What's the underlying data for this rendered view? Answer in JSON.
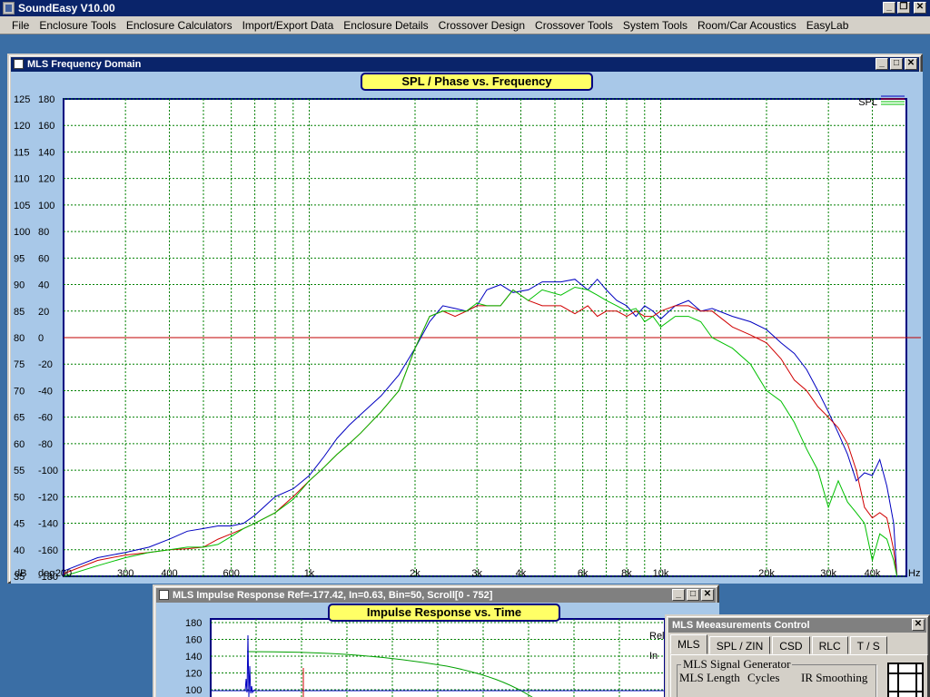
{
  "app": {
    "title": "SoundEasy V10.00"
  },
  "menu": [
    "File",
    "Enclosure Tools",
    "Enclosure Calculators",
    "Import/Export Data",
    "Enclosure Details",
    "Crossover Design",
    "Crossover Tools",
    "System Tools",
    "Room/Car Acoustics",
    "EasyLab"
  ],
  "window_controls": {
    "minimize": "_",
    "restore": "❐",
    "maximize": "□",
    "close": "✕"
  },
  "freq_window": {
    "title": "MLS Frequency Domain",
    "chart_data": {
      "type": "line",
      "title": "SPL / Phase vs. Frequency",
      "x_scale": "log",
      "xlim": [
        200,
        50000
      ],
      "x_tick_labels": [
        "200",
        "300",
        "400",
        "600",
        "1k",
        "2k",
        "3k",
        "4k",
        "6k",
        "8k",
        "10k",
        "20k",
        "30k",
        "40k"
      ],
      "x_tick_values": [
        200,
        300,
        400,
        600,
        1000,
        2000,
        3000,
        4000,
        6000,
        8000,
        10000,
        20000,
        30000,
        40000
      ],
      "x_unit": "Hz",
      "y_left_unit": "dB",
      "y_right_unit": "deg",
      "y_db_ticks": [
        125,
        120,
        115,
        110,
        105,
        100,
        95,
        90,
        85,
        80,
        75,
        70,
        65,
        60,
        55,
        50,
        45,
        40,
        35
      ],
      "y_deg_ticks": [
        180,
        160,
        140,
        120,
        100,
        80,
        60,
        40,
        20,
        0,
        -20,
        -40,
        -60,
        -80,
        -100,
        -120,
        -140,
        -160,
        -180
      ],
      "ylim": [
        35,
        125
      ],
      "legend": {
        "label": "SPL",
        "position": "top-right"
      },
      "grid": true,
      "reference_line_db": 80,
      "series": [
        {
          "color": "#0000c0",
          "points": [
            [
              200,
              36
            ],
            [
              250,
              38.5
            ],
            [
              300,
              39.5
            ],
            [
              350,
              40.5
            ],
            [
              400,
              42
            ],
            [
              450,
              43.5
            ],
            [
              500,
              44
            ],
            [
              550,
              44.5
            ],
            [
              600,
              44.5
            ],
            [
              650,
              45
            ],
            [
              700,
              46.5
            ],
            [
              800,
              50
            ],
            [
              900,
              51.5
            ],
            [
              1000,
              54
            ],
            [
              1100,
              57.5
            ],
            [
              1200,
              61
            ],
            [
              1300,
              63.5
            ],
            [
              1400,
              65.5
            ],
            [
              1600,
              69
            ],
            [
              1800,
              73
            ],
            [
              2000,
              78
            ],
            [
              2200,
              83
            ],
            [
              2400,
              86
            ],
            [
              2600,
              85.5
            ],
            [
              2800,
              85
            ],
            [
              3000,
              86
            ],
            [
              3200,
              89
            ],
            [
              3500,
              90
            ],
            [
              3800,
              88.5
            ],
            [
              4200,
              89
            ],
            [
              4600,
              90.5
            ],
            [
              5200,
              90.5
            ],
            [
              5700,
              91
            ],
            [
              6200,
              89
            ],
            [
              6600,
              91
            ],
            [
              7000,
              89
            ],
            [
              7500,
              87
            ],
            [
              8000,
              86
            ],
            [
              8500,
              84
            ],
            [
              9000,
              86
            ],
            [
              9500,
              85
            ],
            [
              10000,
              83.5
            ],
            [
              11000,
              86
            ],
            [
              12000,
              87
            ],
            [
              13000,
              85
            ],
            [
              14000,
              85.5
            ],
            [
              16000,
              84
            ],
            [
              18000,
              83
            ],
            [
              20000,
              81.5
            ],
            [
              22000,
              79
            ],
            [
              24000,
              77
            ],
            [
              26000,
              74
            ],
            [
              28000,
              70
            ],
            [
              30000,
              66
            ],
            [
              32000,
              62
            ],
            [
              34000,
              58
            ],
            [
              36000,
              53
            ],
            [
              38000,
              54.5
            ],
            [
              40000,
              54
            ],
            [
              42000,
              57
            ],
            [
              44000,
              52
            ],
            [
              46000,
              45
            ],
            [
              47000,
              35
            ]
          ]
        },
        {
          "color": "#d00000",
          "points": [
            [
              200,
              35.5
            ],
            [
              250,
              38
            ],
            [
              300,
              39
            ],
            [
              350,
              39.5
            ],
            [
              400,
              40
            ],
            [
              450,
              40.2
            ],
            [
              500,
              40.5
            ],
            [
              550,
              42
            ],
            [
              600,
              43
            ],
            [
              650,
              44
            ],
            [
              700,
              45
            ],
            [
              800,
              47
            ],
            [
              900,
              50
            ],
            [
              1000,
              53
            ],
            [
              1100,
              55.5
            ],
            [
              1200,
              58
            ],
            [
              1300,
              60
            ],
            [
              1400,
              62
            ],
            [
              1600,
              66
            ],
            [
              1800,
              70
            ],
            [
              2000,
              78
            ],
            [
              2200,
              84
            ],
            [
              2400,
              85
            ],
            [
              2600,
              84
            ],
            [
              2800,
              85
            ],
            [
              3000,
              86
            ],
            [
              3200,
              86
            ],
            [
              3500,
              86
            ],
            [
              3800,
              89
            ],
            [
              4200,
              87
            ],
            [
              4600,
              86
            ],
            [
              5200,
              86
            ],
            [
              5700,
              84.5
            ],
            [
              6200,
              86
            ],
            [
              6600,
              84
            ],
            [
              7000,
              85
            ],
            [
              7500,
              85
            ],
            [
              8000,
              84
            ],
            [
              8500,
              85
            ],
            [
              9000,
              84
            ],
            [
              9500,
              84
            ],
            [
              10000,
              85
            ],
            [
              11000,
              86
            ],
            [
              12000,
              86
            ],
            [
              13000,
              85
            ],
            [
              14000,
              85
            ],
            [
              16000,
              82
            ],
            [
              18000,
              80.5
            ],
            [
              20000,
              79
            ],
            [
              22000,
              76
            ],
            [
              24000,
              72
            ],
            [
              26000,
              70
            ],
            [
              28000,
              67
            ],
            [
              30000,
              65
            ],
            [
              32000,
              63
            ],
            [
              34000,
              60
            ],
            [
              36000,
              55
            ],
            [
              38000,
              48
            ],
            [
              40000,
              46
            ],
            [
              42000,
              47
            ],
            [
              44000,
              46
            ],
            [
              46000,
              40
            ],
            [
              47000,
              35
            ]
          ]
        },
        {
          "color": "#00c000",
          "points": [
            [
              200,
              35
            ],
            [
              250,
              37
            ],
            [
              300,
              38.5
            ],
            [
              350,
              39.5
            ],
            [
              400,
              40
            ],
            [
              450,
              40.5
            ],
            [
              500,
              40.5
            ],
            [
              550,
              41
            ],
            [
              600,
              42.5
            ],
            [
              650,
              44
            ],
            [
              700,
              45
            ],
            [
              800,
              47
            ],
            [
              900,
              49.5
            ],
            [
              1000,
              53
            ],
            [
              1100,
              55.5
            ],
            [
              1200,
              58
            ],
            [
              1300,
              60
            ],
            [
              1400,
              62
            ],
            [
              1600,
              66
            ],
            [
              1800,
              70
            ],
            [
              2000,
              78
            ],
            [
              2200,
              84
            ],
            [
              2400,
              85
            ],
            [
              2600,
              85
            ],
            [
              2800,
              85
            ],
            [
              3000,
              86.5
            ],
            [
              3200,
              86
            ],
            [
              3500,
              86
            ],
            [
              3800,
              89
            ],
            [
              4200,
              87
            ],
            [
              4600,
              89
            ],
            [
              5200,
              88
            ],
            [
              5700,
              89.5
            ],
            [
              6200,
              89
            ],
            [
              6600,
              88
            ],
            [
              7000,
              87
            ],
            [
              7500,
              86
            ],
            [
              8000,
              85
            ],
            [
              8500,
              85.5
            ],
            [
              9000,
              83
            ],
            [
              9500,
              84
            ],
            [
              10000,
              82
            ],
            [
              11000,
              84
            ],
            [
              12000,
              84
            ],
            [
              13000,
              83
            ],
            [
              14000,
              80
            ],
            [
              16000,
              78
            ],
            [
              18000,
              75
            ],
            [
              20000,
              70
            ],
            [
              22000,
              68
            ],
            [
              24000,
              64
            ],
            [
              26000,
              59
            ],
            [
              28000,
              55
            ],
            [
              30000,
              48
            ],
            [
              32000,
              53
            ],
            [
              34000,
              49
            ],
            [
              36000,
              47
            ],
            [
              38000,
              45
            ],
            [
              40000,
              38
            ],
            [
              42000,
              43
            ],
            [
              44000,
              42
            ],
            [
              46000,
              38
            ],
            [
              47000,
              35
            ]
          ]
        }
      ]
    }
  },
  "impulse_window": {
    "title": "MLS Impulse Response  Ref=-177.42, In=0.63, Bin=50, Scroll[0 - 752]",
    "chart_data": {
      "type": "line",
      "title": "Impulse Response vs. Time",
      "y_tick_labels": [
        "180",
        "160",
        "140",
        "120",
        "100"
      ],
      "side_labels": [
        "Rel",
        "In"
      ]
    }
  },
  "mls_control": {
    "title": "MLS Meeasurements Control",
    "tabs": [
      "MLS",
      "SPL / ZIN",
      "CSD",
      "RLC",
      "T / S"
    ],
    "active_tab": 0,
    "group_label": "MLS Signal Generator",
    "fields": [
      "MLS Length",
      "Cycles",
      "IR Smoothing"
    ]
  }
}
